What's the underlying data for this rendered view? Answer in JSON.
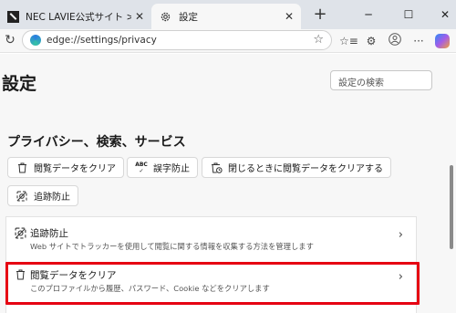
{
  "tabs": [
    {
      "title": "NEC LAVIE公式サイト > サービス&サ",
      "icon": "nec-logo-icon",
      "active": false
    },
    {
      "title": "設定",
      "icon": "gear-icon",
      "active": true
    }
  ],
  "address_bar": {
    "url": "edge://settings/privacy"
  },
  "page": {
    "title": "設定",
    "search_placeholder": "設定の検索",
    "section_title": "プライバシー、検索、サービス"
  },
  "quick_actions": [
    {
      "label": "閲覧データをクリア",
      "icon": "trash-icon"
    },
    {
      "label": "誤字防止",
      "icon": "abc-spellcheck-icon"
    },
    {
      "label": "閉じるときに閲覧データをクリアする",
      "icon": "trash-clock-icon"
    },
    {
      "label": "追跡防止",
      "icon": "tracking-prevention-icon"
    }
  ],
  "settings_rows": [
    {
      "title": "追跡防止",
      "description": "Web サイトでトラッカーを使用して閲覧に関する情報を収集する方法を管理します",
      "icon": "tracking-prevention-icon"
    },
    {
      "title": "閲覧データをクリア",
      "description": "このプロファイルから履歴、パスワード、Cookie などをクリアします",
      "icon": "trash-icon"
    }
  ],
  "colors": {
    "highlight": "#e60012",
    "tab_strip": "#dfe3e9",
    "page_bg": "#f7f7f7"
  }
}
